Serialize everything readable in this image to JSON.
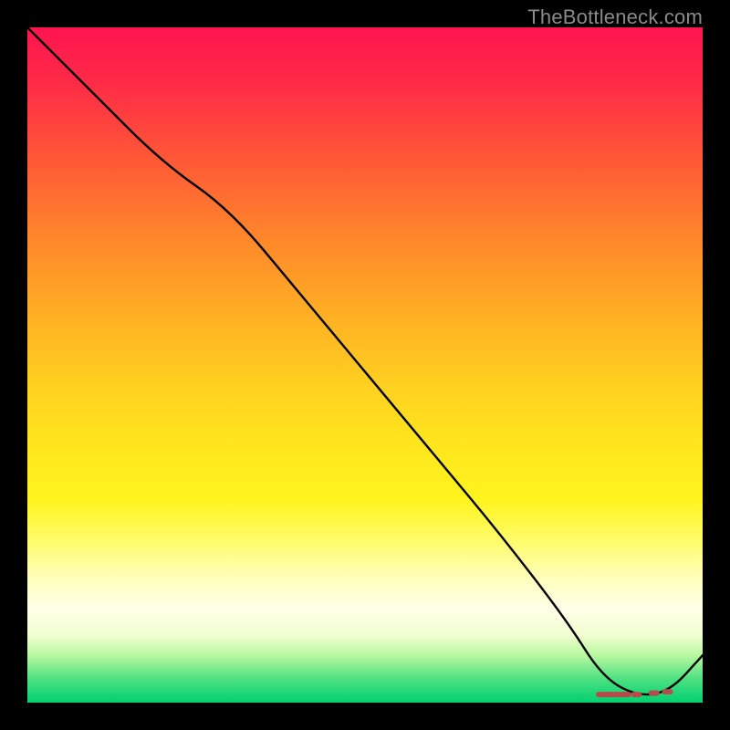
{
  "watermark": "TheBottleneck.com",
  "chart_data": {
    "type": "line",
    "title": "",
    "xlabel": "",
    "ylabel": "",
    "x": [
      0,
      10,
      20,
      30,
      40,
      50,
      60,
      70,
      80,
      85,
      90,
      95,
      100
    ],
    "values": [
      100,
      90,
      80,
      73,
      61,
      49,
      37,
      25,
      12,
      4,
      1,
      1.5,
      7
    ],
    "xlim": [
      0,
      100
    ],
    "ylim": [
      0,
      100
    ],
    "background": "heat-gradient",
    "markers": {
      "shape": "dash",
      "color": "#b54b4b",
      "items": [
        {
          "x": 85.0,
          "y": 1.2
        },
        {
          "x": 86.2,
          "y": 1.2
        },
        {
          "x": 87.4,
          "y": 1.2
        },
        {
          "x": 88.6,
          "y": 1.2
        },
        {
          "x": 90.2,
          "y": 1.2
        },
        {
          "x": 92.8,
          "y": 1.4
        },
        {
          "x": 94.8,
          "y": 1.6
        }
      ]
    }
  }
}
